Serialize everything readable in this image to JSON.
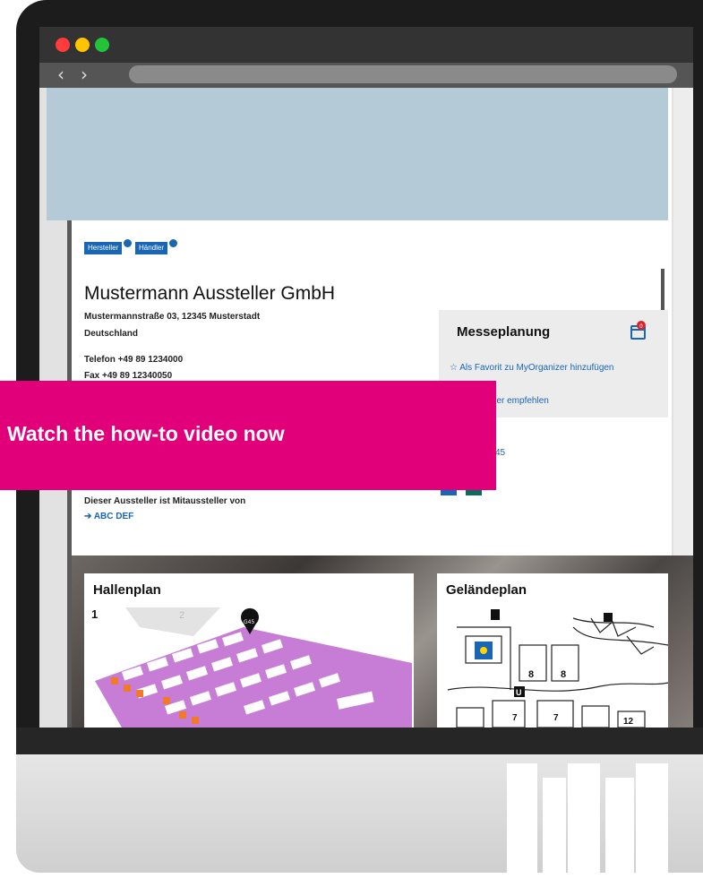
{
  "browser": {
    "window_controls": [
      "close-dot",
      "minimize-dot",
      "maximize-dot"
    ],
    "back_arrow": "‹",
    "forward_arrow": "›"
  },
  "exhibitor": {
    "badges": [
      "Hersteller",
      "Händler"
    ],
    "name": "Mustermann Aussteller GmbH",
    "address_line": "Mustermannstraße 03, 12345 Musterstadt",
    "country": "Deutschland",
    "phone": "Telefon +49 89 1234000",
    "fax": "Fax +49 89 12340050",
    "coexhibitor_label": "Dieser Aussteller ist Mitaussteller von",
    "coexhibitor_link": "ABC DEF"
  },
  "planning": {
    "title": "Messeplanung",
    "favorite_link": "Als Favorit zu MyOrganizer hinzufügen",
    "recommend_link": "ller empfehlen",
    "notification_count": "0",
    "hall_stand_ref": "45"
  },
  "overlay": {
    "cta": "Watch the how-to video now"
  },
  "maps": {
    "hall_title": "Hallenplan",
    "hall_number": "1",
    "hall_neighbor": "2",
    "stand_marker": "G45",
    "site_title": "Geländeplan",
    "site_labels": [
      "8",
      "8",
      "7",
      "7",
      "12",
      "U"
    ]
  },
  "colors": {
    "accent_blue": "#1866b4",
    "cta_pink": "#e2007a",
    "banner": "#b4cbd7",
    "hall_purple": "#c77dd6"
  }
}
